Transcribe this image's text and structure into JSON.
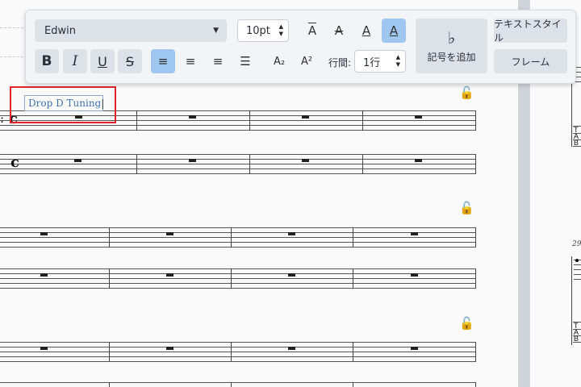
{
  "toolbar": {
    "font_family": "Edwin",
    "font_size": "10pt",
    "line_spacing_label": "行間:",
    "line_spacing_value": "1行",
    "add_symbol_label": "記号を追加",
    "text_style_label": "テキストスタイル",
    "frame_label": "フレーム",
    "bold": "B",
    "italic": "I",
    "underline": "U",
    "strike": "S",
    "subscript": "A₂",
    "superscript": "A²",
    "flat_glyph": "♭"
  },
  "score": {
    "text_element": "Drop D Tuning",
    "measure_number_right": "29"
  },
  "colors": {
    "lock": "#d4267e",
    "highlight": "#e0242c",
    "selected": "#9ec6ef"
  }
}
